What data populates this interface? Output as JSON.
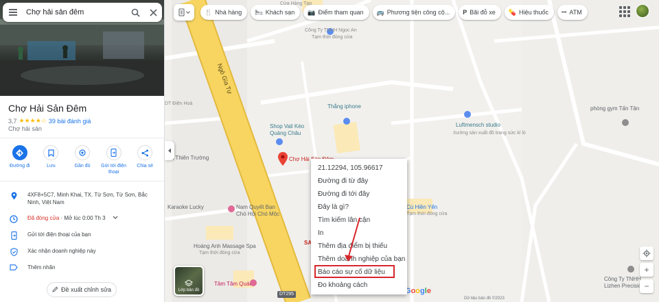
{
  "search": {
    "value": "Chợ hải sản đêm"
  },
  "place": {
    "title": "Chợ Hải Sản Đêm",
    "rating": "3,7",
    "stars": "★★★★☆",
    "reviews": "39 bài đánh giá",
    "category": "Chợ hải sản"
  },
  "actions": [
    {
      "label": "Đường đi"
    },
    {
      "label": "Lưu"
    },
    {
      "label": "Gần đó"
    },
    {
      "label": "Gửi tới điện thoại"
    },
    {
      "label": "Chia sẻ"
    }
  ],
  "info": {
    "address": "4XF8+5C7, Minh Khai, TX. Từ Sơn, Từ Sơn, Bắc Ninh, Việt Nam",
    "hours_status": "Đã đóng cửa",
    "hours_next": " · Mở lúc 0:00 Th 3",
    "send_to_phone": "Gửi tới điện thoại của bạn",
    "claim": "Xác nhận doanh nghiệp này",
    "add_label": "Thêm nhãn"
  },
  "suggest_edit": "Đề xuất chỉnh sửa",
  "chips": [
    {
      "label": "Nhà hàng",
      "icon": "restaurant-icon",
      "glyph": "🍴"
    },
    {
      "label": "Khách sạn",
      "icon": "hotel-icon",
      "glyph": "🛏"
    },
    {
      "label": "Điểm tham quan",
      "icon": "camera-icon",
      "glyph": "📷"
    },
    {
      "label": "Phương tiện công cộ...",
      "icon": "transit-icon",
      "glyph": "🚌"
    },
    {
      "label": "Bãi đỗ xe",
      "icon": "parking-icon",
      "glyph": "P"
    },
    {
      "label": "Hiệu thuốc",
      "icon": "pharmacy-icon",
      "glyph": "💊"
    },
    {
      "label": "ATM",
      "icon": "more-icon",
      "glyph": "•••"
    }
  ],
  "context_menu": [
    "21.12294, 105.96617",
    "Đường đi từ đây",
    "Đường đi tới đây",
    "Đây là gì?",
    "Tìm kiếm lân cận",
    "In",
    "Thêm địa điểm bị thiếu",
    "Thêm doanh nghiệp của bạn",
    "Báo cáo sự cố dữ liệu",
    "Đo khoảng cách"
  ],
  "map_labels": {
    "road_main": "Ngô Gia Tự",
    "road_tag": "DT295",
    "store_top": "Cửa Hàng Tạp",
    "company_nguyen_an": "Công Ty TNHH Ngọc An",
    "temp_closed": "Tạm thời đóng cửa",
    "iphone": "Thắng iphone",
    "vali_shop": "Shop Vali Kéo Quảng Châu",
    "dien_hoa": "DT Điện Hoà",
    "market_pin": "Chợ Hải Sản Đêm",
    "thien_truong": "oon Thiên Trường",
    "karaoke": "Karaoke Lucky",
    "nam_quyet": "Nam Quyết Bạn Chó Hội Chó Mộc",
    "massage": "Hoàng Anh Massage Spa",
    "tam_quan": "Tâm Tâm Quán",
    "luftmensch": "Luftmensch studio",
    "luftmensch_sub": "Xưởng sản xuất đồ trang sức kỉ lò",
    "gym": "phòng gym Tấn Tân",
    "hieu_yen": "Cú Hiền Yến",
    "lizhen": "Công Ty TNHH Lizhen Precision",
    "sale": "SALE"
  },
  "layers_label": "Lớp bản đồ",
  "google": "Google",
  "copyright": "Dữ liệu bản đồ ©2023",
  "colors": {
    "accent": "#1a73e8",
    "closed": "#d93025",
    "highlight": "#d5252b",
    "road": "#f7d560",
    "pin": "#ea4335"
  }
}
